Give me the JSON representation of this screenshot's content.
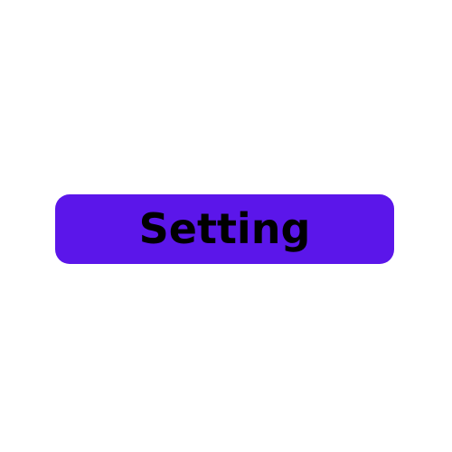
{
  "button": {
    "label": "Setting",
    "background_color": "#5b16ea",
    "text_color": "#000000"
  }
}
